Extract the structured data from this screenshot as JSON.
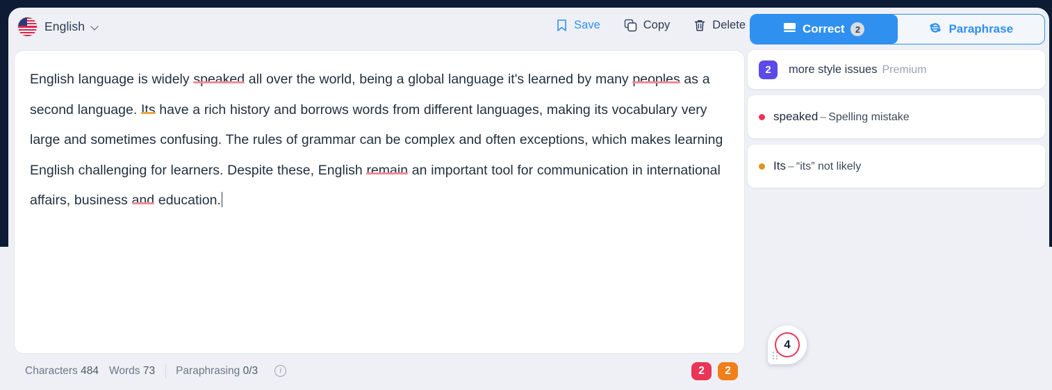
{
  "header": {
    "language": "English",
    "language_icon": "us-flag-icon",
    "chevron_icon": "chevron-down-icon",
    "actions": [
      {
        "label": "Save",
        "icon": "bookmark-icon"
      },
      {
        "label": "Copy",
        "icon": "copy-icon"
      },
      {
        "label": "Delete",
        "icon": "trash-icon"
      }
    ],
    "modes": [
      {
        "label": "Correct",
        "icon": "keyboard-icon",
        "badge": "2",
        "active": true
      },
      {
        "label": "Paraphrase",
        "icon": "refresh-cycle-icon",
        "badge": "",
        "active": false
      }
    ]
  },
  "editor": {
    "segments": [
      {
        "text": "English language is widely "
      },
      {
        "text": "speaked",
        "error": "red"
      },
      {
        "text": " all over the world, being a global language it's learned by many "
      },
      {
        "text": "peoples",
        "error": "red"
      },
      {
        "text": " as a second language. "
      },
      {
        "text": "Its",
        "error": "amber"
      },
      {
        "text": " have a rich history and borrows words from different languages, making its vocabulary very large and sometimes confusing. The rules of grammar can be complex and often exceptions, which makes learning English challenging for learners. Despite these, English "
      },
      {
        "text": "remain",
        "error": "red"
      },
      {
        "text": " an important tool for communication in international affairs, business "
      },
      {
        "text": "and",
        "error": "red"
      },
      {
        "text": " education."
      }
    ]
  },
  "statusbar": {
    "characters_label": "Characters",
    "characters_value": "484",
    "words_label": "Words",
    "words_value": "73",
    "paraphrasing_label": "Paraphrasing",
    "paraphrasing_value": "0/3",
    "info_icon": "info-icon",
    "badges": [
      {
        "value": "2",
        "color": "#ea3556"
      },
      {
        "value": "2",
        "color": "#f07f1a"
      }
    ]
  },
  "sidebar": {
    "premium_card": {
      "badge": "2",
      "title": "more style issues",
      "tag": "Premium"
    },
    "issues": [
      {
        "word": "speaked",
        "dash": "–",
        "description": "Spelling mistake",
        "dot": "red"
      },
      {
        "word": "Its",
        "dash": "–",
        "description": "“its” not likely",
        "dot": "amber"
      }
    ]
  },
  "score_bubble": {
    "value": "4",
    "grip_icon": "drag-handle-icon"
  },
  "colors": {
    "app_background": "#0d1b34",
    "panel": "#eef0f5",
    "accent_blue": "#2f90f0",
    "error_red": "#ea3556",
    "warning_amber": "#d9971f",
    "premium_purple": "#5b4ae8",
    "orange": "#f07f1a"
  }
}
